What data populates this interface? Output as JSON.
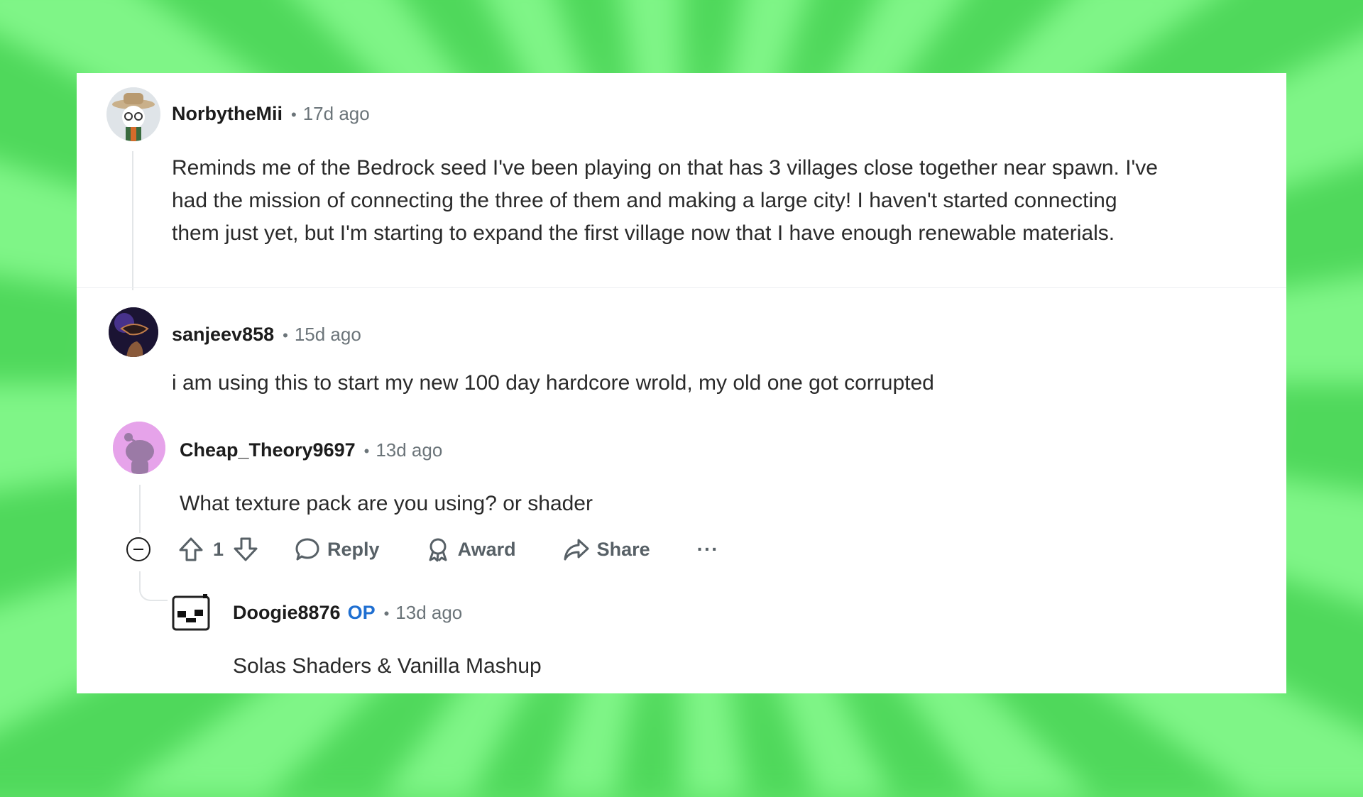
{
  "comments": [
    {
      "author": "NorbytheMii",
      "time": "17d ago",
      "text": "Reminds me of the Bedrock seed I've been playing on that has 3 villages close together near spawn. I've had the mission of connecting the three of them and making a large city! I haven't started connecting them just yet, but I'm starting to expand the first village now that I have enough renewable materials."
    },
    {
      "author": "sanjeev858",
      "time": "15d ago",
      "text": "i am using this to start my new 100 day hardcore wrold, my old one got corrupted"
    },
    {
      "author": "Cheap_Theory9697",
      "time": "13d ago",
      "text": "What texture pack are you using? or shader",
      "votes": "1",
      "actions": {
        "reply": "Reply",
        "award": "Award",
        "share": "Share",
        "more": "···"
      }
    },
    {
      "author": "Doogie8876",
      "op_badge": "OP",
      "time": "13d ago",
      "text": "Solas Shaders & Vanilla Mashup"
    }
  ],
  "separator": "•",
  "colors": {
    "op": "#1f6fd1",
    "meta": "#6b7479",
    "text": "#2a2a2a",
    "background": "#5fe36a"
  }
}
